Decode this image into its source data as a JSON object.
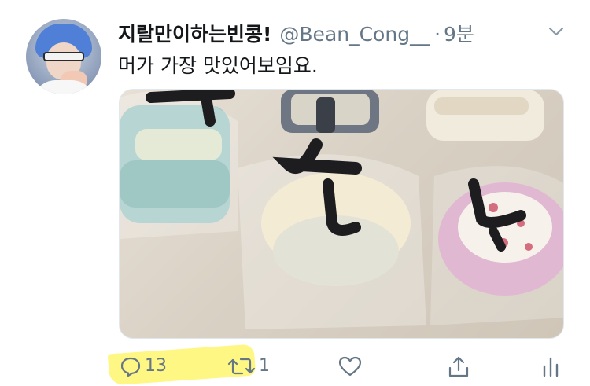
{
  "tweet": {
    "display_name": "지랄만이하는빈콩!",
    "handle": "@Bean_Cong__",
    "separator": "·",
    "time": "9분",
    "text": "머가 가장 맛있어보임요."
  },
  "media": {
    "description_icon": "photo-macarons"
  },
  "actions": {
    "reply_count": "13",
    "retweet_count": "1",
    "like_count": "",
    "share_icon": "share-icon",
    "analytics_icon": "analytics-icon"
  },
  "colors": {
    "text": "#14171a",
    "muted": "#657786",
    "highlight": "#fff66e"
  }
}
